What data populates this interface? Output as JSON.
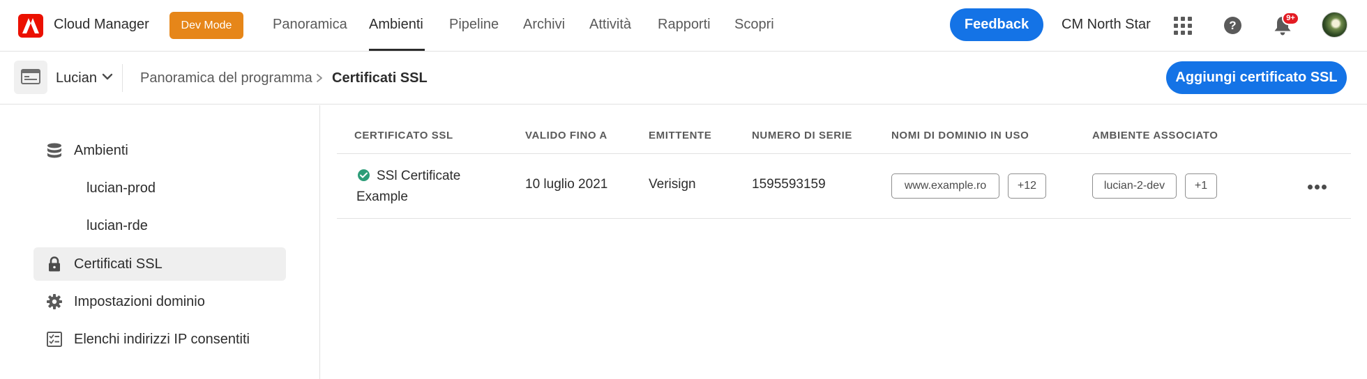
{
  "header": {
    "app_name": "Cloud Manager",
    "dev_mode_label": "Dev Mode",
    "nav_tabs": [
      "Panoramica",
      "Ambienti",
      "Pipeline",
      "Archivi",
      "Attività",
      "Rapporti",
      "Scopri"
    ],
    "active_tab": "Ambienti",
    "feedback_label": "Feedback",
    "org_name": "CM North Star",
    "notification_count": "9+",
    "icons": [
      "adobe-logo-icon",
      "apps-grid-icon",
      "help-icon",
      "bell-icon",
      "avatar"
    ]
  },
  "subheader": {
    "program_name": "Lucian",
    "breadcrumb": [
      "Panoramica del programma",
      "Certificati SSL"
    ],
    "add_button_label": "Aggiungi certificato SSL"
  },
  "sidebar": {
    "items": [
      {
        "label": "Ambienti",
        "icon": "database-icon",
        "active": false
      },
      {
        "label": "lucian-prod",
        "icon": "",
        "active": false
      },
      {
        "label": "lucian-rde",
        "icon": "",
        "active": false
      },
      {
        "label": "Certificati SSL",
        "icon": "lock-icon",
        "active": true
      },
      {
        "label": "Impostazioni dominio",
        "icon": "gear-icon",
        "active": false
      },
      {
        "label": "Elenchi indirizzi IP consentiti",
        "icon": "checklist-icon",
        "active": false
      }
    ]
  },
  "table": {
    "columns": [
      "CERTIFICATO SSL",
      "VALIDO FINO A",
      "EMITTENTE",
      "NUMERO DI SERIE",
      "NOMI DI DOMINIO IN USO",
      "AMBIENTE ASSOCIATO"
    ],
    "rows": [
      {
        "name": "SSl Certificate Example",
        "status": "valid",
        "valid_until": "10 luglio 2021",
        "issuer": "Verisign",
        "serial": "1595593159",
        "domain": "www.example.ro",
        "domain_more": "+12",
        "environment": "lucian-2-dev",
        "environment_more": "+1"
      }
    ]
  },
  "colors": {
    "brand_red": "#eb1000",
    "dev_mode_orange": "#e68619",
    "accent_blue": "#1473e6",
    "status_green": "#2d9d78",
    "badge_red": "#e31b23"
  }
}
